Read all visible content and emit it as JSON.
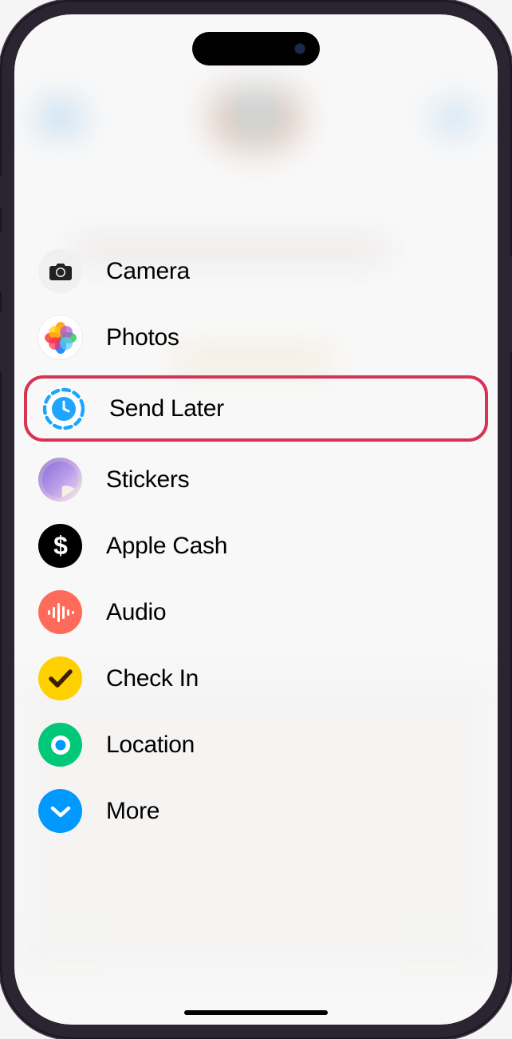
{
  "menu": {
    "items": [
      {
        "id": "camera",
        "label": "Camera",
        "icon": "camera-icon",
        "highlighted": false
      },
      {
        "id": "photos",
        "label": "Photos",
        "icon": "photos-icon",
        "highlighted": false
      },
      {
        "id": "send-later",
        "label": "Send Later",
        "icon": "clock-dashed-icon",
        "highlighted": true
      },
      {
        "id": "stickers",
        "label": "Stickers",
        "icon": "stickers-icon",
        "highlighted": false
      },
      {
        "id": "apple-cash",
        "label": "Apple Cash",
        "icon": "dollar-icon",
        "highlighted": false
      },
      {
        "id": "audio",
        "label": "Audio",
        "icon": "waveform-icon",
        "highlighted": false
      },
      {
        "id": "check-in",
        "label": "Check In",
        "icon": "checkmark-icon",
        "highlighted": false
      },
      {
        "id": "location",
        "label": "Location",
        "icon": "location-dot-icon",
        "highlighted": false
      },
      {
        "id": "more",
        "label": "More",
        "icon": "chevron-down-icon",
        "highlighted": false
      }
    ]
  },
  "colors": {
    "highlight_border": "#d63454",
    "send_later_blue": "#1ea5ff",
    "audio_coral": "#ff6b5a",
    "checkin_yellow": "#ffd000",
    "location_green": "#00c878",
    "more_blue": "#0099ff"
  }
}
